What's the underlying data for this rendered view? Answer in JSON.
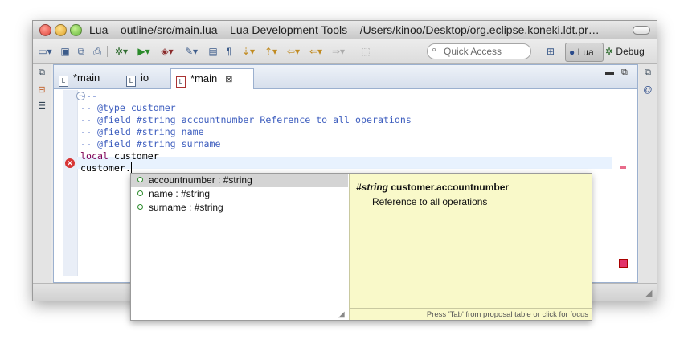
{
  "window": {
    "title": "Lua – outline/src/main.lua – Lua Development Tools – /Users/kinoo/Desktop/org.eclipse.koneki.ldt.pr…"
  },
  "toolbar": {
    "quick_access_placeholder": "Quick Access",
    "perspective_lua": "Lua",
    "perspective_debug": "Debug"
  },
  "tabs": [
    {
      "label": "*main"
    },
    {
      "label": "io"
    },
    {
      "label": "*main",
      "active": true
    }
  ],
  "code": {
    "lines": [
      {
        "text": "---",
        "style": "comment"
      },
      {
        "text": "-- @type customer",
        "style": "comment"
      },
      {
        "text": "-- @field #string accountnumber Reference to all operations",
        "style": "comment"
      },
      {
        "text": "-- @field #string name",
        "style": "comment"
      },
      {
        "text": "-- @field #string surname",
        "style": "comment"
      },
      {
        "keyword": "local",
        "text": " customer",
        "style": "keyword"
      },
      {
        "text": "customer.",
        "style": "plain"
      }
    ]
  },
  "completion": {
    "proposals": [
      {
        "label": "accountnumber : #string",
        "selected": true
      },
      {
        "label": "name : #string",
        "selected": false
      },
      {
        "label": "surname : #string",
        "selected": false
      }
    ],
    "info": {
      "type": "#string",
      "title": "customer.accountnumber",
      "description": "Reference to all operations",
      "footer": "Press 'Tab' from proposal table or click for focus"
    }
  },
  "colors": {
    "comment": "#3f5fbf",
    "keyword": "#7f0055",
    "info_background": "#f9f9c9",
    "selection": "#d4d4d4",
    "error": "#d73535"
  }
}
